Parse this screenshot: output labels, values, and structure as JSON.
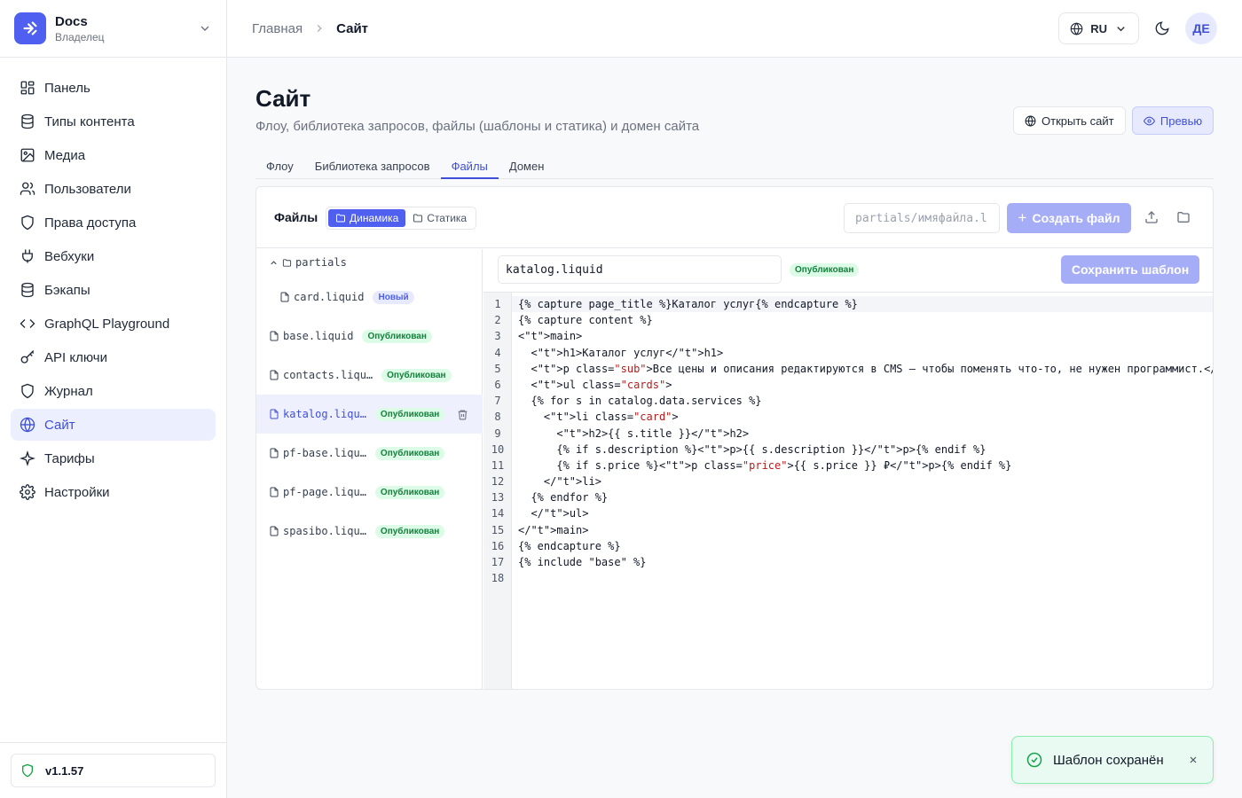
{
  "brand": {
    "name": "Docs",
    "role": "Владелец"
  },
  "sidebar": {
    "items": [
      {
        "label": "Панель",
        "icon": "dashboard-icon"
      },
      {
        "label": "Типы контента",
        "icon": "database-icon"
      },
      {
        "label": "Медиа",
        "icon": "image-icon"
      },
      {
        "label": "Пользователи",
        "icon": "users-icon"
      },
      {
        "label": "Права доступа",
        "icon": "shield-icon"
      },
      {
        "label": "Вебхуки",
        "icon": "plug-icon"
      },
      {
        "label": "Бэкапы",
        "icon": "database-icon"
      },
      {
        "label": "GraphQL Playground",
        "icon": "code-icon"
      },
      {
        "label": "API ключи",
        "icon": "key-icon"
      },
      {
        "label": "Журнал",
        "icon": "shield-icon"
      },
      {
        "label": "Сайт",
        "icon": "globe-icon",
        "active": true
      },
      {
        "label": "Тарифы",
        "icon": "sparkle-icon"
      },
      {
        "label": "Настройки",
        "icon": "gear-icon"
      }
    ],
    "version": "v1.1.57"
  },
  "topbar": {
    "breadcrumb": [
      "Главная",
      "Сайт"
    ],
    "lang": "RU",
    "avatar": "ДЕ"
  },
  "page": {
    "title": "Сайт",
    "subtitle": "Флоу, библиотека запросов, файлы (шаблоны и статика) и домен сайта",
    "open_site": "Открыть сайт",
    "preview": "Превью",
    "tabs": [
      "Флоу",
      "Библиотека запросов",
      "Файлы",
      "Домен"
    ],
    "active_tab": "Файлы"
  },
  "files": {
    "label": "Файлы",
    "seg": [
      "Динамика",
      "Статика"
    ],
    "new_placeholder": "partials/имяфайла.liquid",
    "create": "Создать файл",
    "folder": "partials",
    "list": [
      {
        "name": "card.liquid",
        "badge": "Новый",
        "type": "new",
        "nested": true
      },
      {
        "name": "base.liquid",
        "badge": "Опубликован",
        "type": "pub"
      },
      {
        "name": "contacts.liqu…",
        "badge": "Опубликован",
        "type": "pub"
      },
      {
        "name": "katalog.liqu…",
        "badge": "Опубликован",
        "type": "pub",
        "active": true
      },
      {
        "name": "pf-base.liqu…",
        "badge": "Опубликован",
        "type": "pub"
      },
      {
        "name": "pf-page.liqu…",
        "badge": "Опубликован",
        "type": "pub"
      },
      {
        "name": "spasibo.liqu…",
        "badge": "Опубликован",
        "type": "pub"
      }
    ]
  },
  "editor": {
    "filename": "katalog.liquid",
    "status": "Опубликован",
    "save": "Сохранить шаблон",
    "lines": [
      "{% capture page_title %}Каталог услуг{% endcapture %}",
      "{% capture content %}",
      "<main>",
      "  <h1>Каталог услуг</h1>",
      "  <p class=\"sub\">Все цены и описания редактируются в CMS — чтобы поменять что-то, не нужен программист.</p>",
      "  <ul class=\"cards\">",
      "  {% for s in catalog.data.services %}",
      "    <li class=\"card\">",
      "      <h2>{{ s.title }}</h2>",
      "      {% if s.description %}<p>{{ s.description }}</p>{% endif %}",
      "      {% if s.price %}<p class=\"price\">{{ s.price }} ₽</p>{% endif %}",
      "    </li>",
      "  {% endfor %}",
      "  </ul>",
      "</main>",
      "{% endcapture %}",
      "{% include \"base\" %}",
      ""
    ]
  },
  "toast": {
    "text": "Шаблон сохранён"
  }
}
